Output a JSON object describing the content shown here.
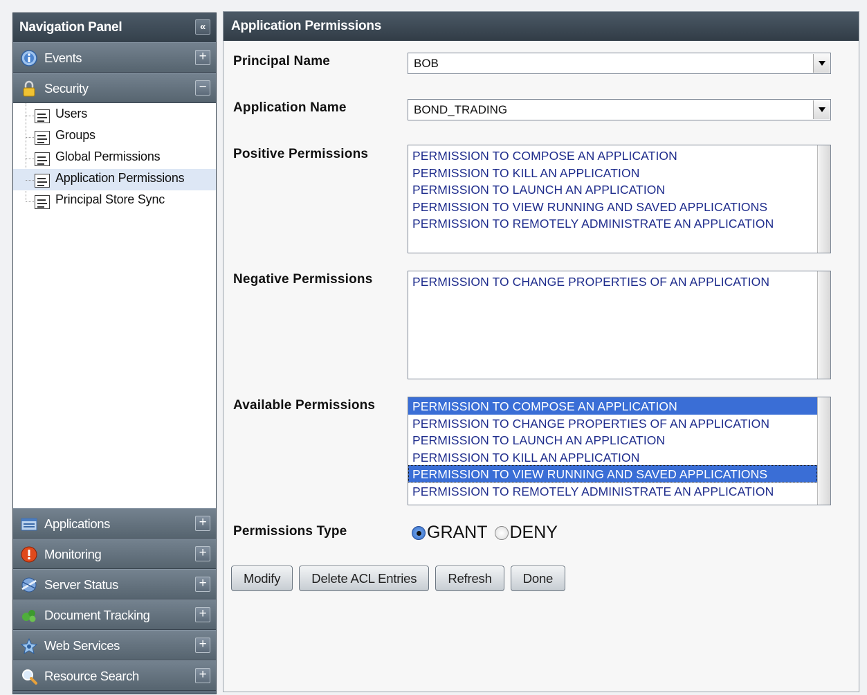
{
  "nav": {
    "title": "Navigation Panel",
    "collapse_glyph": "«",
    "sections_top": [
      {
        "label": "Events",
        "icon": "info-icon",
        "toggle": "+"
      },
      {
        "label": "Security",
        "icon": "lock-icon",
        "toggle": "−"
      }
    ],
    "security_items": [
      {
        "label": "Users"
      },
      {
        "label": "Groups"
      },
      {
        "label": "Global Permissions"
      },
      {
        "label": "Application Permissions",
        "selected": true
      },
      {
        "label": "Principal Store Sync"
      }
    ],
    "sections_bottom": [
      {
        "label": "Applications",
        "icon": "applications-icon",
        "toggle": "+"
      },
      {
        "label": "Monitoring",
        "icon": "monitoring-alert-icon",
        "toggle": "+"
      },
      {
        "label": "Server Status",
        "icon": "server-status-icon",
        "toggle": "+"
      },
      {
        "label": "Document Tracking",
        "icon": "document-tracking-icon",
        "toggle": "+"
      },
      {
        "label": "Web Services",
        "icon": "web-services-icon",
        "toggle": "+"
      },
      {
        "label": "Resource Search",
        "icon": "magnifier-icon",
        "toggle": "+"
      }
    ]
  },
  "main": {
    "title": "Application Permissions",
    "principal_label": "Principal Name",
    "principal_value": "BOB",
    "application_label": "Application Name",
    "application_value": "BOND_TRADING",
    "positive_label": "Positive Permissions",
    "positive_items": [
      "PERMISSION TO COMPOSE AN APPLICATION",
      "PERMISSION TO KILL AN APPLICATION",
      "PERMISSION TO LAUNCH AN APPLICATION",
      "PERMISSION TO VIEW RUNNING AND SAVED APPLICATIONS",
      "PERMISSION TO REMOTELY ADMINISTRATE AN APPLICATION"
    ],
    "negative_label": "Negative Permissions",
    "negative_items": [
      "PERMISSION TO CHANGE PROPERTIES OF AN APPLICATION"
    ],
    "available_label": "Available Permissions",
    "available_items": [
      {
        "text": "PERMISSION TO COMPOSE AN APPLICATION",
        "selected": true
      },
      {
        "text": "PERMISSION TO CHANGE PROPERTIES OF AN APPLICATION"
      },
      {
        "text": "PERMISSION TO LAUNCH AN APPLICATION"
      },
      {
        "text": "PERMISSION TO KILL AN APPLICATION"
      },
      {
        "text": "PERMISSION TO VIEW RUNNING AND SAVED APPLICATIONS",
        "selected": true,
        "focused": true
      },
      {
        "text": "PERMISSION TO REMOTELY ADMINISTRATE AN APPLICATION"
      }
    ],
    "permissions_type_label": "Permissions Type",
    "grant_label": "GRANT",
    "deny_label": "DENY",
    "selected_type": "GRANT",
    "buttons": {
      "modify": "Modify",
      "delete": "Delete ACL Entries",
      "refresh": "Refresh",
      "done": "Done"
    }
  },
  "colors": {
    "selection": "#3a6ed6",
    "list_text": "#1e2c8c",
    "header_bg": "#3b4753"
  }
}
